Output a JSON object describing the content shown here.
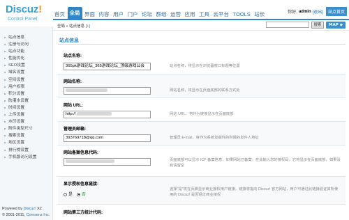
{
  "logo": {
    "brand": "Discuz",
    "bang": "!",
    "subtitle": "Control Panel"
  },
  "nav": {
    "items": [
      "首页",
      "全局",
      "界面",
      "内容",
      "用户",
      "门户",
      "论坛",
      "群组",
      "运营",
      "应用",
      "工具",
      "云平台",
      "TOOLS",
      "站长"
    ],
    "active_index": 1
  },
  "userinfo": {
    "greeting": "你好,",
    "username": "admin",
    "logout": "[退出]",
    "home": "站点首页"
  },
  "breadcrumb": {
    "path": "全局 » 站点信息",
    "add": "[+]"
  },
  "search": {
    "value": "",
    "button": "搜索",
    "map": "MAP ◆"
  },
  "sidebar": {
    "items": [
      "站点信息",
      "注册与访问",
      "站点功能",
      "性能优化",
      "SEO设置",
      "域名设置",
      "空间设置",
      "用户权限",
      "积分设置",
      "防灌水设置",
      "时间设置",
      "上传设置",
      "水印设置",
      "附件类型尺寸",
      "搜索设置",
      "地区设置",
      "排行榜设置",
      "手机版访问设置"
    ],
    "powered_prefix": "Powered by",
    "powered_brand": "Discuz!",
    "powered_version": "X2",
    "copyright_prefix": "© 2001-2011,",
    "copyright_company": "Comsenz Inc."
  },
  "section": {
    "title": "站点信息"
  },
  "fields": [
    {
      "label": "站点名称:",
      "value": "365pk游戏论坛_365游戏论坛_顶级游戏公会",
      "desc": "站点名称，将显示在浏览器窗口标题等位置"
    },
    {
      "label": "网站名称:",
      "value": "",
      "desc": "网站名称，将显示在页面底部的联系方式处"
    },
    {
      "label": "网站 URL:",
      "value": "http://",
      "desc": "网站 URL，将作为链接显示在页面底部"
    },
    {
      "label": "管理员邮箱:",
      "value": "393769718@qq.com",
      "desc": "管理员 E-mail，将作为系统发邮件的时候的发件人地址"
    },
    {
      "label": "网站备案信息代码:",
      "value": "",
      "desc": "页面底部可以显示 ICP 备案信息，如果网站已备案，在此输入您的授权码，它将显示在页面底部，如果没有请留空"
    },
    {
      "label": "显示授权信息链接:",
      "radio_yes": "是",
      "radio_no": "否",
      "desc": "选择\"是\"将在页脚显示商业授权用户链接，链接将指向 Discuz! 官方网站，用户可通过此链接验证其所使用的 Discuz! 是否经过商业授权"
    },
    {
      "label": "网站第三方统计代码:"
    }
  ]
}
